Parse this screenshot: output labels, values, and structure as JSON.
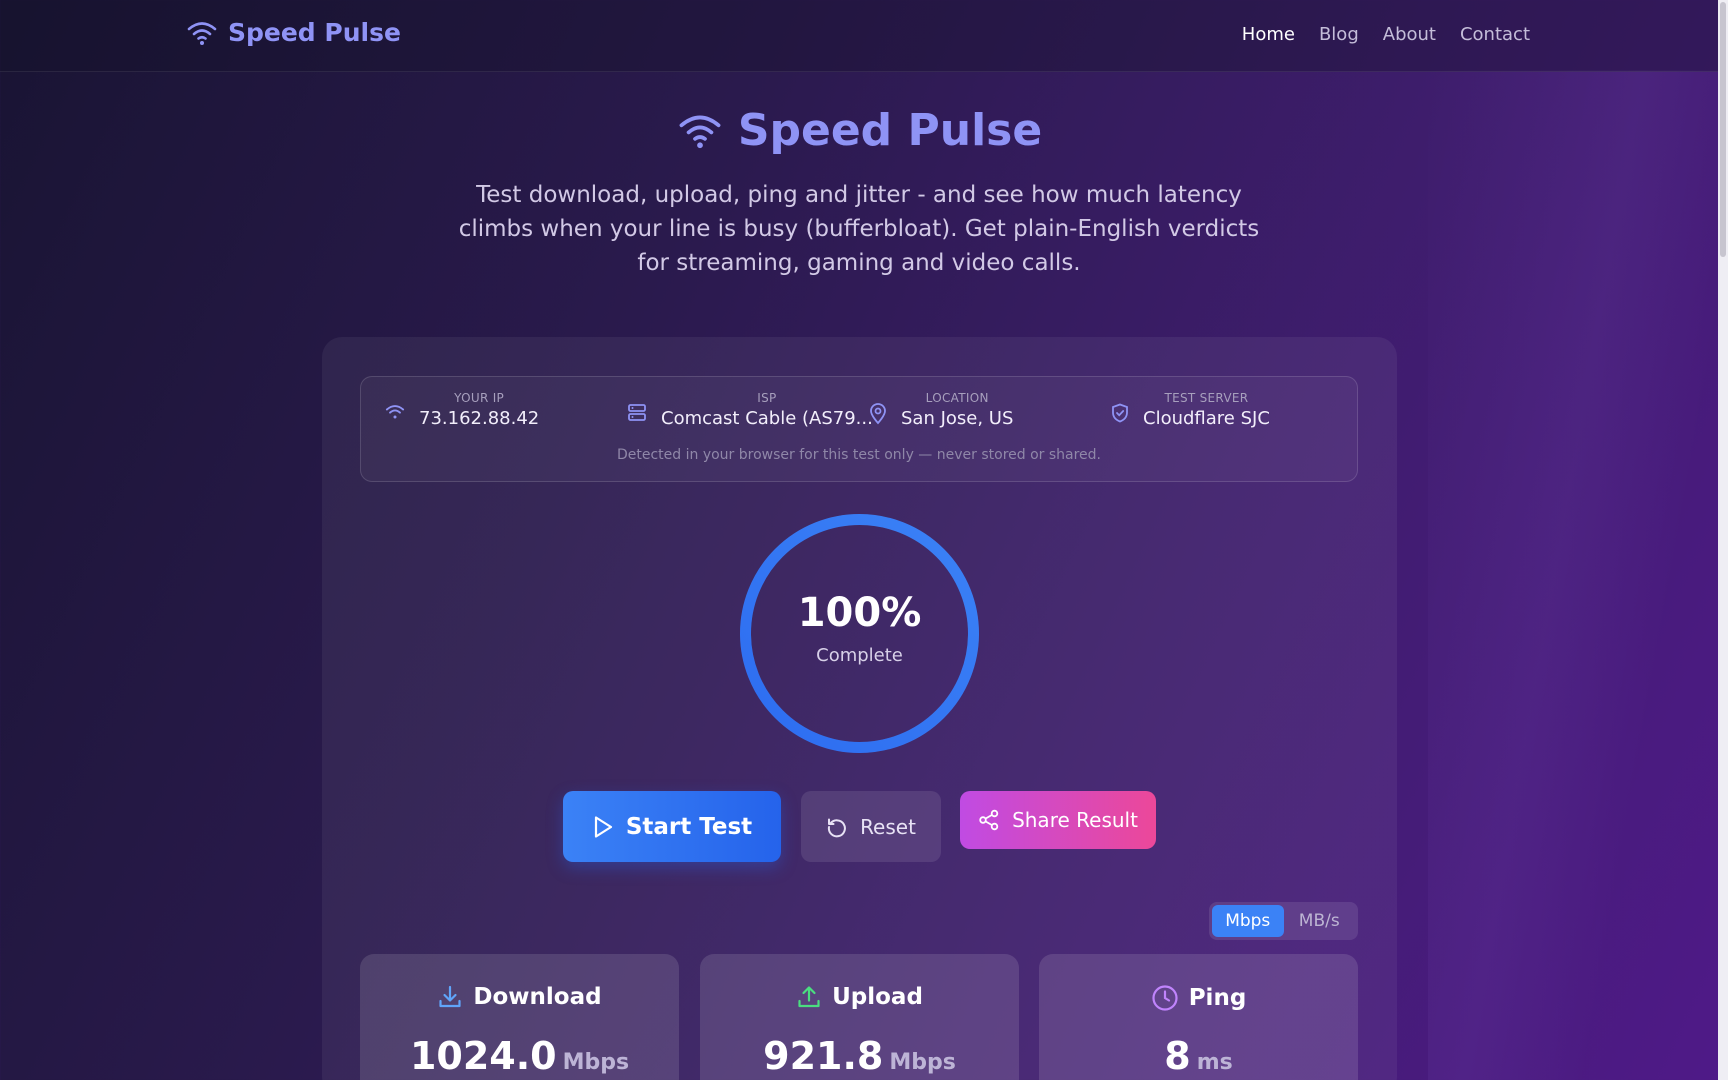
{
  "brand": {
    "name": "Speed Pulse"
  },
  "nav": {
    "links": [
      "Home",
      "Blog",
      "About",
      "Contact"
    ],
    "active": "Home"
  },
  "hero": {
    "title": "Speed Pulse",
    "subtitle": "Test download, upload, ping and jitter - and see how much latency climbs when your line is busy (bufferbloat). Get plain-English verdicts for streaming, gaming and video calls."
  },
  "info": {
    "ip": {
      "label": "YOUR IP",
      "value": "73.162.88.42",
      "icon": "wifi-icon"
    },
    "isp": {
      "label": "ISP",
      "value": "Comcast Cable (AS79...",
      "icon": "server-icon"
    },
    "location": {
      "label": "LOCATION",
      "value": "San Jose, US",
      "icon": "map-pin-icon"
    },
    "server": {
      "label": "TEST SERVER",
      "value": "Cloudflare SJC",
      "icon": "shield-check-icon"
    },
    "note": "Detected in your browser for this test only — never stored or shared."
  },
  "gauge": {
    "percent_text": "100%",
    "progress": 1.0,
    "label": "Complete"
  },
  "buttons": {
    "start": "Start Test",
    "reset": "Reset",
    "share": "Share Result"
  },
  "units": {
    "options": [
      "Mbps",
      "MB/s"
    ],
    "selected": "Mbps"
  },
  "metrics": [
    {
      "label": "Download",
      "value": "1024.0",
      "unit": "Mbps",
      "icon": "download-icon",
      "color": "#60a5fa"
    },
    {
      "label": "Upload",
      "value": "921.8",
      "unit": "Mbps",
      "icon": "upload-icon",
      "color": "#4ade80"
    },
    {
      "label": "Ping",
      "value": "8",
      "unit": "ms",
      "icon": "clock-icon",
      "color": "#c084fc"
    }
  ],
  "colors": {
    "accent": "#8f93f5",
    "primary_button": "#3b82f6",
    "share_gradient": [
      "#c04be3",
      "#ec4899"
    ]
  }
}
